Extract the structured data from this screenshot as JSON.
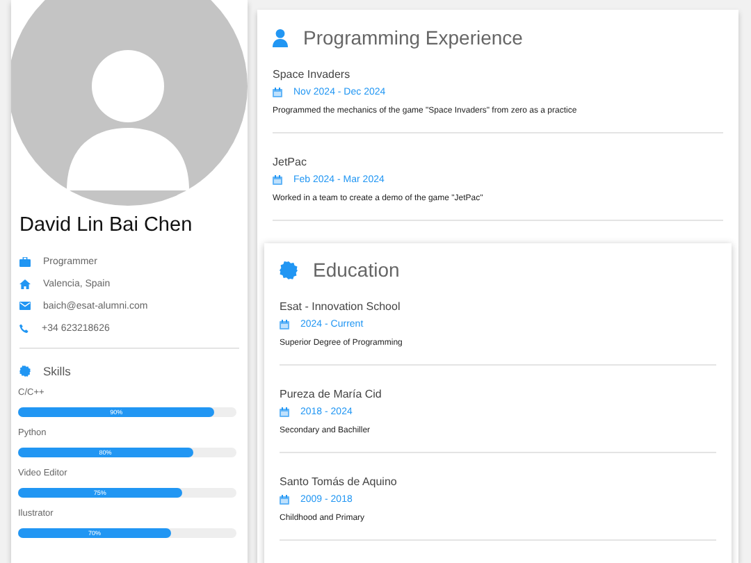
{
  "profile": {
    "name": "David Lin Bai Chen",
    "contacts": [
      {
        "kind": "job",
        "text": "Programmer"
      },
      {
        "kind": "home",
        "text": "Valencia, Spain"
      },
      {
        "kind": "mail",
        "text": "baich@esat-alumni.com"
      },
      {
        "kind": "phone",
        "text": "+34 623218626"
      }
    ],
    "skills_title": "Skills",
    "skills": [
      {
        "name": "C/C++",
        "level": 0.9,
        "reading": "90%"
      },
      {
        "name": "Python",
        "level": 0.8,
        "reading": "80%"
      },
      {
        "name": "Video Editor",
        "level": 0.75,
        "reading": "75%"
      },
      {
        "name": "Ilustrator",
        "level": 0.7,
        "reading": "70%"
      }
    ]
  },
  "experience": {
    "title": "Programming Experience",
    "items": [
      {
        "title": "Space Invaders",
        "dates": "Nov 2024 - Dec 2024",
        "description": "Programmed the mechanics of the game \"Space Invaders\" from zero as a practice"
      },
      {
        "title": "JetPac",
        "dates": "Feb 2024 - Mar 2024",
        "description": "Worked in a team to create a demo of the game \"JetPac\""
      }
    ]
  },
  "education": {
    "title": "Education",
    "items": [
      {
        "title": "Esat - Innovation School",
        "dates": "2024 - Current",
        "description": "Superior Degree of Programming"
      },
      {
        "title": "Pureza de María Cid",
        "dates": "2018 - 2024",
        "description": "Secondary and Bachiller"
      },
      {
        "title": "Santo Tomás de Aquino",
        "dates": "2009 - 2018",
        "description": "Childhood and Primary"
      }
    ]
  }
}
